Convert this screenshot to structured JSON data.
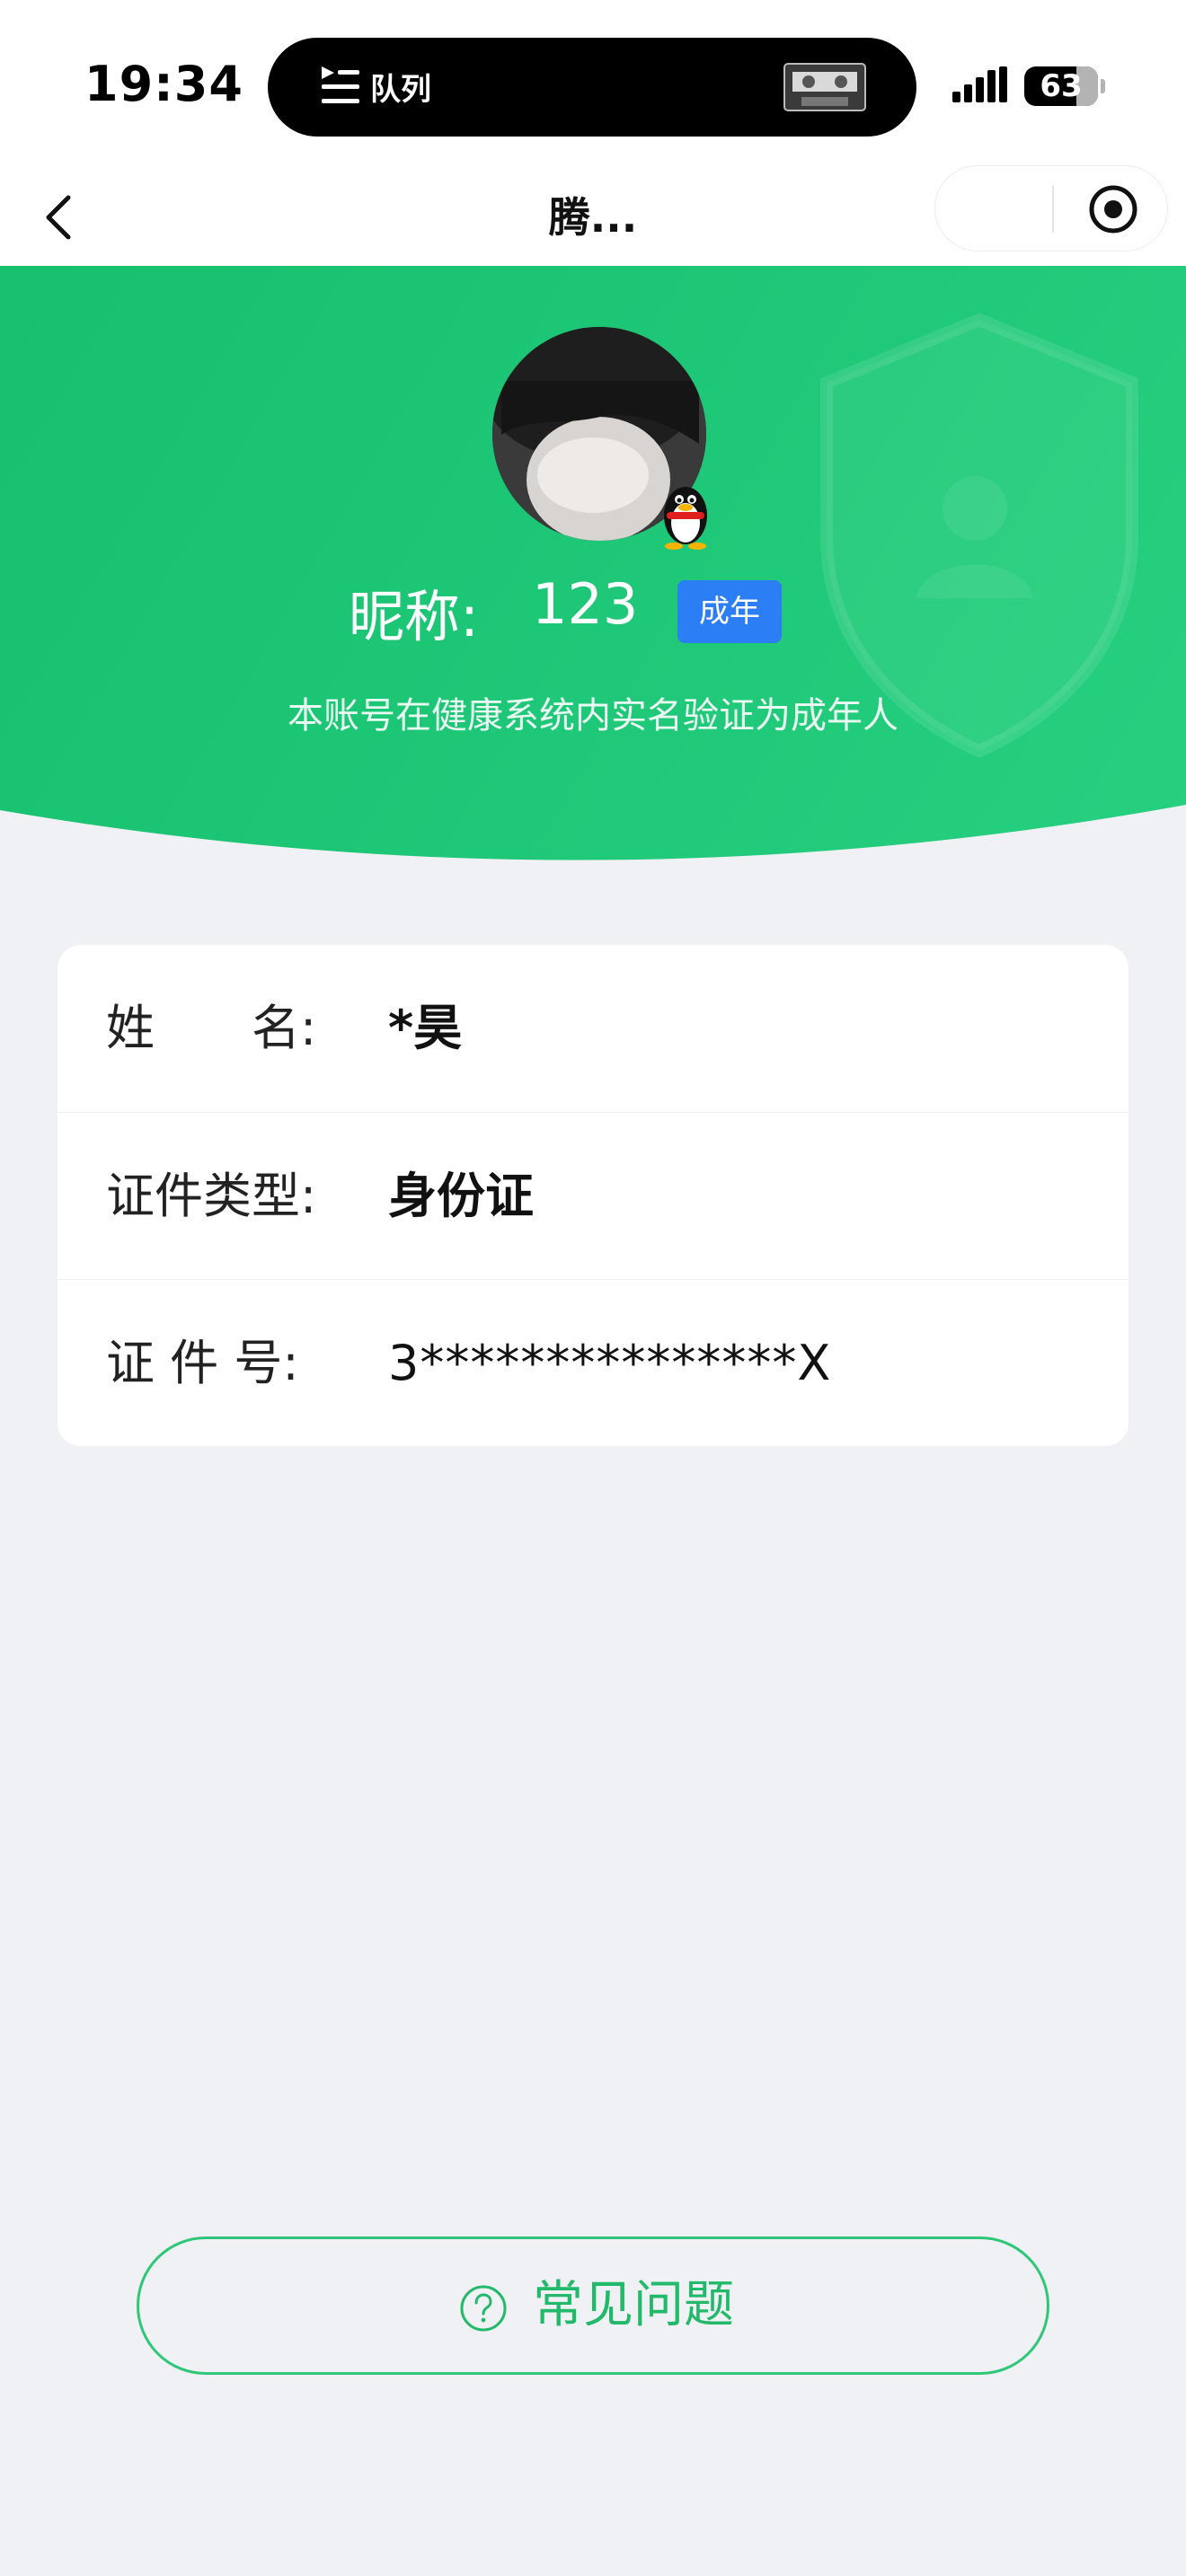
{
  "status_bar": {
    "time": "19:34",
    "live_activity_label": "队列",
    "battery": "63",
    "battery_level": 0.63
  },
  "nav": {
    "title": "腾..."
  },
  "profile": {
    "nickname_label": "昵称:",
    "nickname": "123",
    "badge": "成年",
    "verification_text": "本账号在健康系统内实名验证为成年人",
    "accent_color": "#1fc878",
    "badge_color": "#2c7ef5"
  },
  "info": {
    "rows": [
      {
        "label": "姓　　名:",
        "value": "*昊"
      },
      {
        "label": "证件类型:",
        "value": "身份证"
      },
      {
        "label": "证 件 号:",
        "value": "3***************X"
      }
    ]
  },
  "faq": {
    "label": "常见问题",
    "icon": "question-circle-icon"
  }
}
